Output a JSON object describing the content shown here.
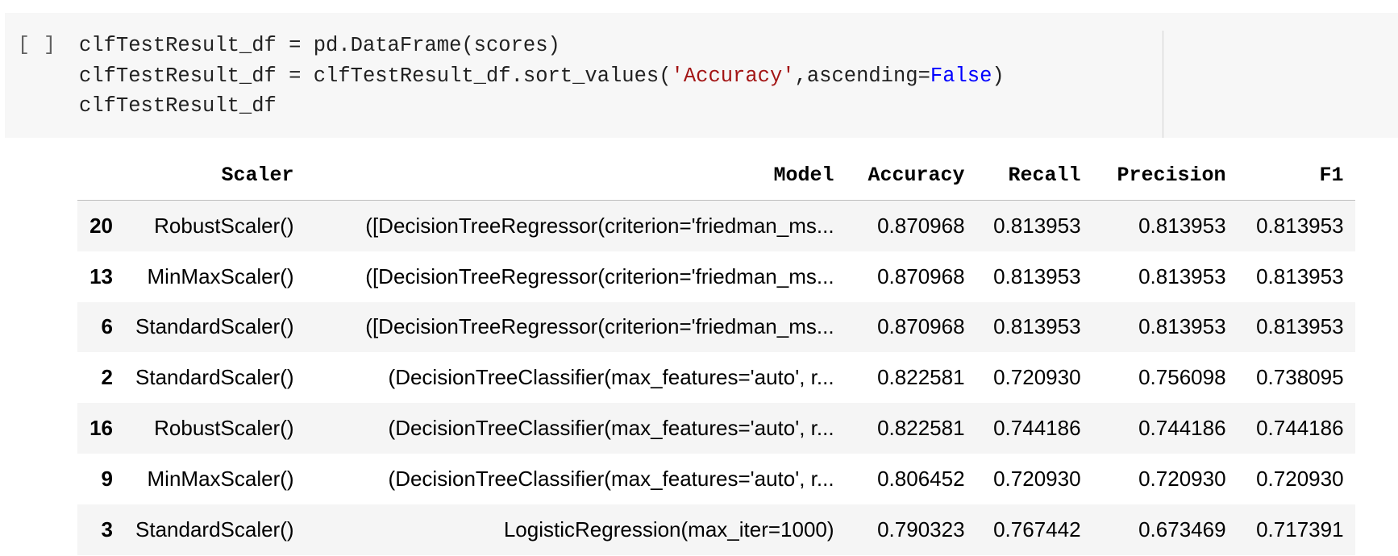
{
  "cell": {
    "run_indicator": "[ ]",
    "code": {
      "line1": "clfTestResult_df = pd.DataFrame(scores)",
      "line2_pre": "clfTestResult_df = clfTestResult_df.sort_values(",
      "line2_str": "'Accuracy'",
      "line2_mid": ",ascending=",
      "line2_kw": "False",
      "line2_post": ")",
      "line3": "clfTestResult_df"
    }
  },
  "output": {
    "columns": [
      "",
      "Scaler",
      "Model",
      "Accuracy",
      "Recall",
      "Precision",
      "F1"
    ],
    "rows": [
      {
        "index": "20",
        "scaler": "RobustScaler()",
        "model": "([DecisionTreeRegressor(criterion='friedman_ms...",
        "accuracy": "0.870968",
        "recall": "0.813953",
        "precision": "0.813953",
        "f1": "0.813953"
      },
      {
        "index": "13",
        "scaler": "MinMaxScaler()",
        "model": "([DecisionTreeRegressor(criterion='friedman_ms...",
        "accuracy": "0.870968",
        "recall": "0.813953",
        "precision": "0.813953",
        "f1": "0.813953"
      },
      {
        "index": "6",
        "scaler": "StandardScaler()",
        "model": "([DecisionTreeRegressor(criterion='friedman_ms...",
        "accuracy": "0.870968",
        "recall": "0.813953",
        "precision": "0.813953",
        "f1": "0.813953"
      },
      {
        "index": "2",
        "scaler": "StandardScaler()",
        "model": "(DecisionTreeClassifier(max_features='auto', r...",
        "accuracy": "0.822581",
        "recall": "0.720930",
        "precision": "0.756098",
        "f1": "0.738095"
      },
      {
        "index": "16",
        "scaler": "RobustScaler()",
        "model": "(DecisionTreeClassifier(max_features='auto', r...",
        "accuracy": "0.822581",
        "recall": "0.744186",
        "precision": "0.744186",
        "f1": "0.744186"
      },
      {
        "index": "9",
        "scaler": "MinMaxScaler()",
        "model": "(DecisionTreeClassifier(max_features='auto', r...",
        "accuracy": "0.806452",
        "recall": "0.720930",
        "precision": "0.720930",
        "f1": "0.720930"
      },
      {
        "index": "3",
        "scaler": "StandardScaler()",
        "model": "LogisticRegression(max_iter=1000)",
        "accuracy": "0.790323",
        "recall": "0.767442",
        "precision": "0.673469",
        "f1": "0.717391"
      }
    ]
  },
  "colors": {
    "cell_background": "#f7f7f7",
    "string_literal": "#a31515",
    "keyword": "#0000ff",
    "stripe_row": "#f5f5f5"
  }
}
